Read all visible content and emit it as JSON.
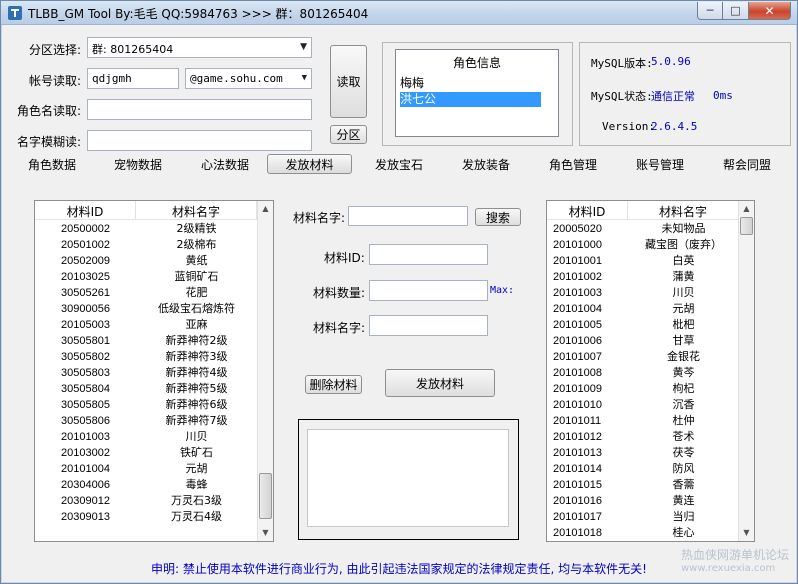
{
  "window": {
    "title": "TLBB_GM Tool By:毛毛 QQ:5984763 >>> 群：801265404",
    "close_glyph": "✕",
    "min_glyph": "─",
    "max_glyph": "□"
  },
  "login": {
    "server_label": "分区选择:",
    "server_value": "群: 801265404",
    "account_label": "帐号读取:",
    "account_value": "qdjgmh",
    "domain_value": "@game.sohu.com",
    "role_label": "角色名读取:",
    "role_value": "",
    "fuzzy_label": "名字模糊读:",
    "fuzzy_value": "",
    "read_button": "读取",
    "zone_button": "分区"
  },
  "role_info": {
    "title": "角色信息",
    "items": [
      "梅梅",
      "洪七公"
    ],
    "selected_index": 1
  },
  "mysql": {
    "version_label": "MySQL版本:",
    "version_value": "5.0.96",
    "status_label": "MySQL状态:",
    "status_value": "通信正常",
    "latency_value": "0ms",
    "app_version_label": "Version:",
    "app_version_value": "2.6.4.5"
  },
  "tabs": [
    "角色数据",
    "宠物数据",
    "心法数据",
    "发放材料",
    "发放宝石",
    "发放装备",
    "角色管理",
    "账号管理",
    "帮会同盟"
  ],
  "active_tab": "发放材料",
  "left_list": {
    "col_id": "材料ID",
    "col_name": "材料名字",
    "rows": [
      [
        "20500002",
        "2级精铁"
      ],
      [
        "20501002",
        "2级棉布"
      ],
      [
        "20502009",
        "黄纸"
      ],
      [
        "20103025",
        "蓝铜矿石"
      ],
      [
        "30505261",
        "花肥"
      ],
      [
        "30900056",
        "低级宝石熔炼符"
      ],
      [
        "20105003",
        "亚麻"
      ],
      [
        "30505801",
        "新莽神符2级"
      ],
      [
        "30505802",
        "新莽神符3级"
      ],
      [
        "30505803",
        "新莽神符4级"
      ],
      [
        "30505804",
        "新莽神符5级"
      ],
      [
        "30505805",
        "新莽神符6级"
      ],
      [
        "30505806",
        "新莽神符7级"
      ],
      [
        "20101003",
        "川贝"
      ],
      [
        "20103002",
        "铁矿石"
      ],
      [
        "20101004",
        "元胡"
      ],
      [
        "20304006",
        "毒蜂"
      ],
      [
        "20309012",
        "万灵石3级"
      ],
      [
        "20309013",
        "万灵石4级"
      ]
    ]
  },
  "form": {
    "search_label": "材料名字:",
    "search_value": "",
    "search_button": "搜索",
    "id_label": "材料ID:",
    "id_value": "",
    "qty_label": "材料数量:",
    "qty_value": "",
    "max_label": "Max:",
    "name_label": "材料名字:",
    "name_value": "",
    "delete_button": "删除材料",
    "issue_button": "发放材料",
    "log_text": ""
  },
  "right_list": {
    "col_id": "材料ID",
    "col_name": "材料名字",
    "rows": [
      [
        "20005020",
        "未知物品"
      ],
      [
        "20101000",
        "藏宝图（废弃）"
      ],
      [
        "20101001",
        "白英"
      ],
      [
        "20101002",
        "蒲黄"
      ],
      [
        "20101003",
        "川贝"
      ],
      [
        "20101004",
        "元胡"
      ],
      [
        "20101005",
        "枇杷"
      ],
      [
        "20101006",
        "甘草"
      ],
      [
        "20101007",
        "金银花"
      ],
      [
        "20101008",
        "黄芩"
      ],
      [
        "20101009",
        "枸杞"
      ],
      [
        "20101010",
        "沉香"
      ],
      [
        "20101011",
        "杜仲"
      ],
      [
        "20101012",
        "苍术"
      ],
      [
        "20101013",
        "茯苓"
      ],
      [
        "20101014",
        "防风"
      ],
      [
        "20101015",
        "香薷"
      ],
      [
        "20101016",
        "黄连"
      ],
      [
        "20101017",
        "当归"
      ],
      [
        "20101018",
        "桂心"
      ]
    ]
  },
  "footer": {
    "disclaimer": "申明: 禁止使用本软件进行商业行为, 由此引起违法国家规定的法律规定责任, 均与本软件无关!",
    "watermark_title": "热血侠网游单机论坛",
    "watermark_url": "www.rexuexia.com"
  },
  "colors": {
    "selection": "#3399ff",
    "mysql_value": "#0000c8",
    "disclaimer": "#0000c8"
  }
}
